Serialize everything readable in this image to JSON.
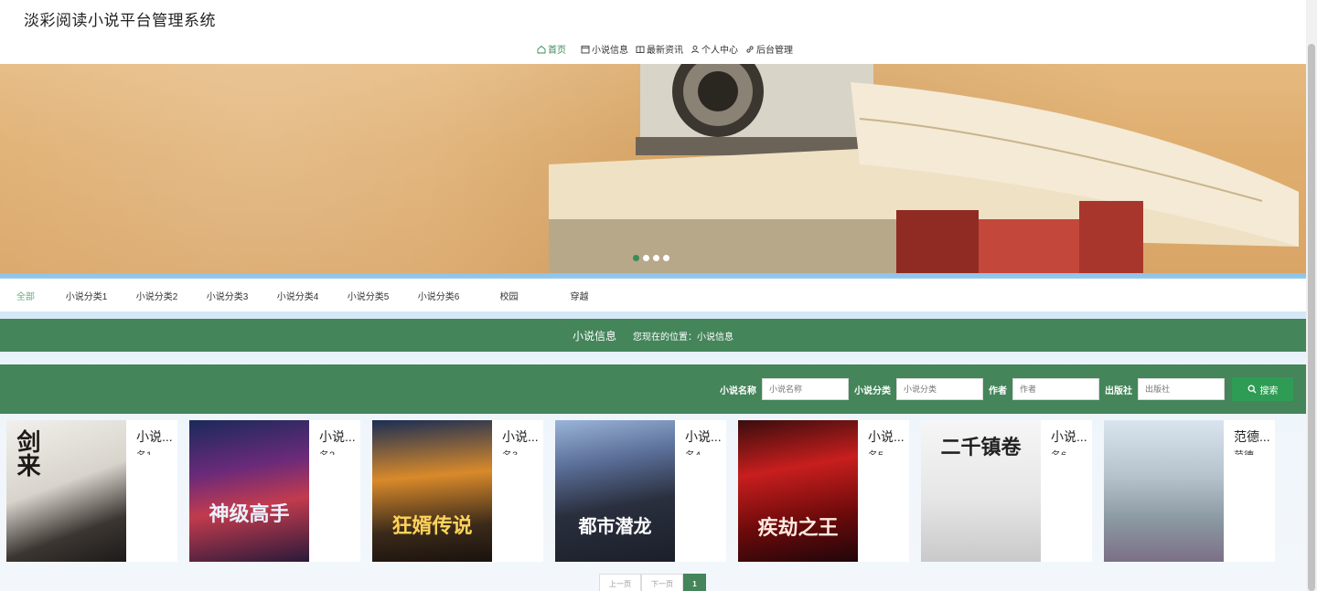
{
  "header": {
    "title": "淡彩阅读小说平台管理系统",
    "nav": [
      {
        "label": "首页",
        "icon": "home-icon",
        "active": true
      },
      {
        "label": "小说信息",
        "icon": "calendar-icon",
        "active": false
      },
      {
        "label": "最新资讯",
        "icon": "news-icon",
        "active": false
      },
      {
        "label": "个人中心",
        "icon": "user-icon",
        "active": false
      },
      {
        "label": "后台管理",
        "icon": "link-icon",
        "active": false
      }
    ]
  },
  "banner": {
    "active_dot": 0,
    "dot_count": 4
  },
  "categories": [
    "全部",
    "小说分类1",
    "小说分类2",
    "小说分类3",
    "小说分类4",
    "小说分类5",
    "小说分类6",
    "校园",
    "穿越"
  ],
  "title_bar": {
    "title": "小说信息",
    "location": "您现在的位置：小说信息"
  },
  "search": {
    "fields": [
      {
        "label": "小说名称",
        "placeholder": "小说名称"
      },
      {
        "label": "小说分类",
        "placeholder": "小说分类"
      },
      {
        "label": "作者",
        "placeholder": "作者"
      },
      {
        "label": "出版社",
        "placeholder": "出版社"
      }
    ],
    "button": "搜索"
  },
  "books": [
    {
      "name": "小说...",
      "sub": "名1",
      "cover_text": "剑来"
    },
    {
      "name": "小说...",
      "sub": "名2",
      "cover_text": "神级高手"
    },
    {
      "name": "小说...",
      "sub": "名3",
      "cover_text": "狂婿传说"
    },
    {
      "name": "小说...",
      "sub": "名4",
      "cover_text": "都市潜龙"
    },
    {
      "name": "小说...",
      "sub": "名5",
      "cover_text": "疾劫之王"
    },
    {
      "name": "小说...",
      "sub": "名6",
      "cover_text": "二千镇卷"
    },
    {
      "name": "范德...",
      "sub": "范德",
      "cover_text": ""
    }
  ],
  "pagination": {
    "prev": "上一页",
    "next": "下一页",
    "current": "1"
  }
}
